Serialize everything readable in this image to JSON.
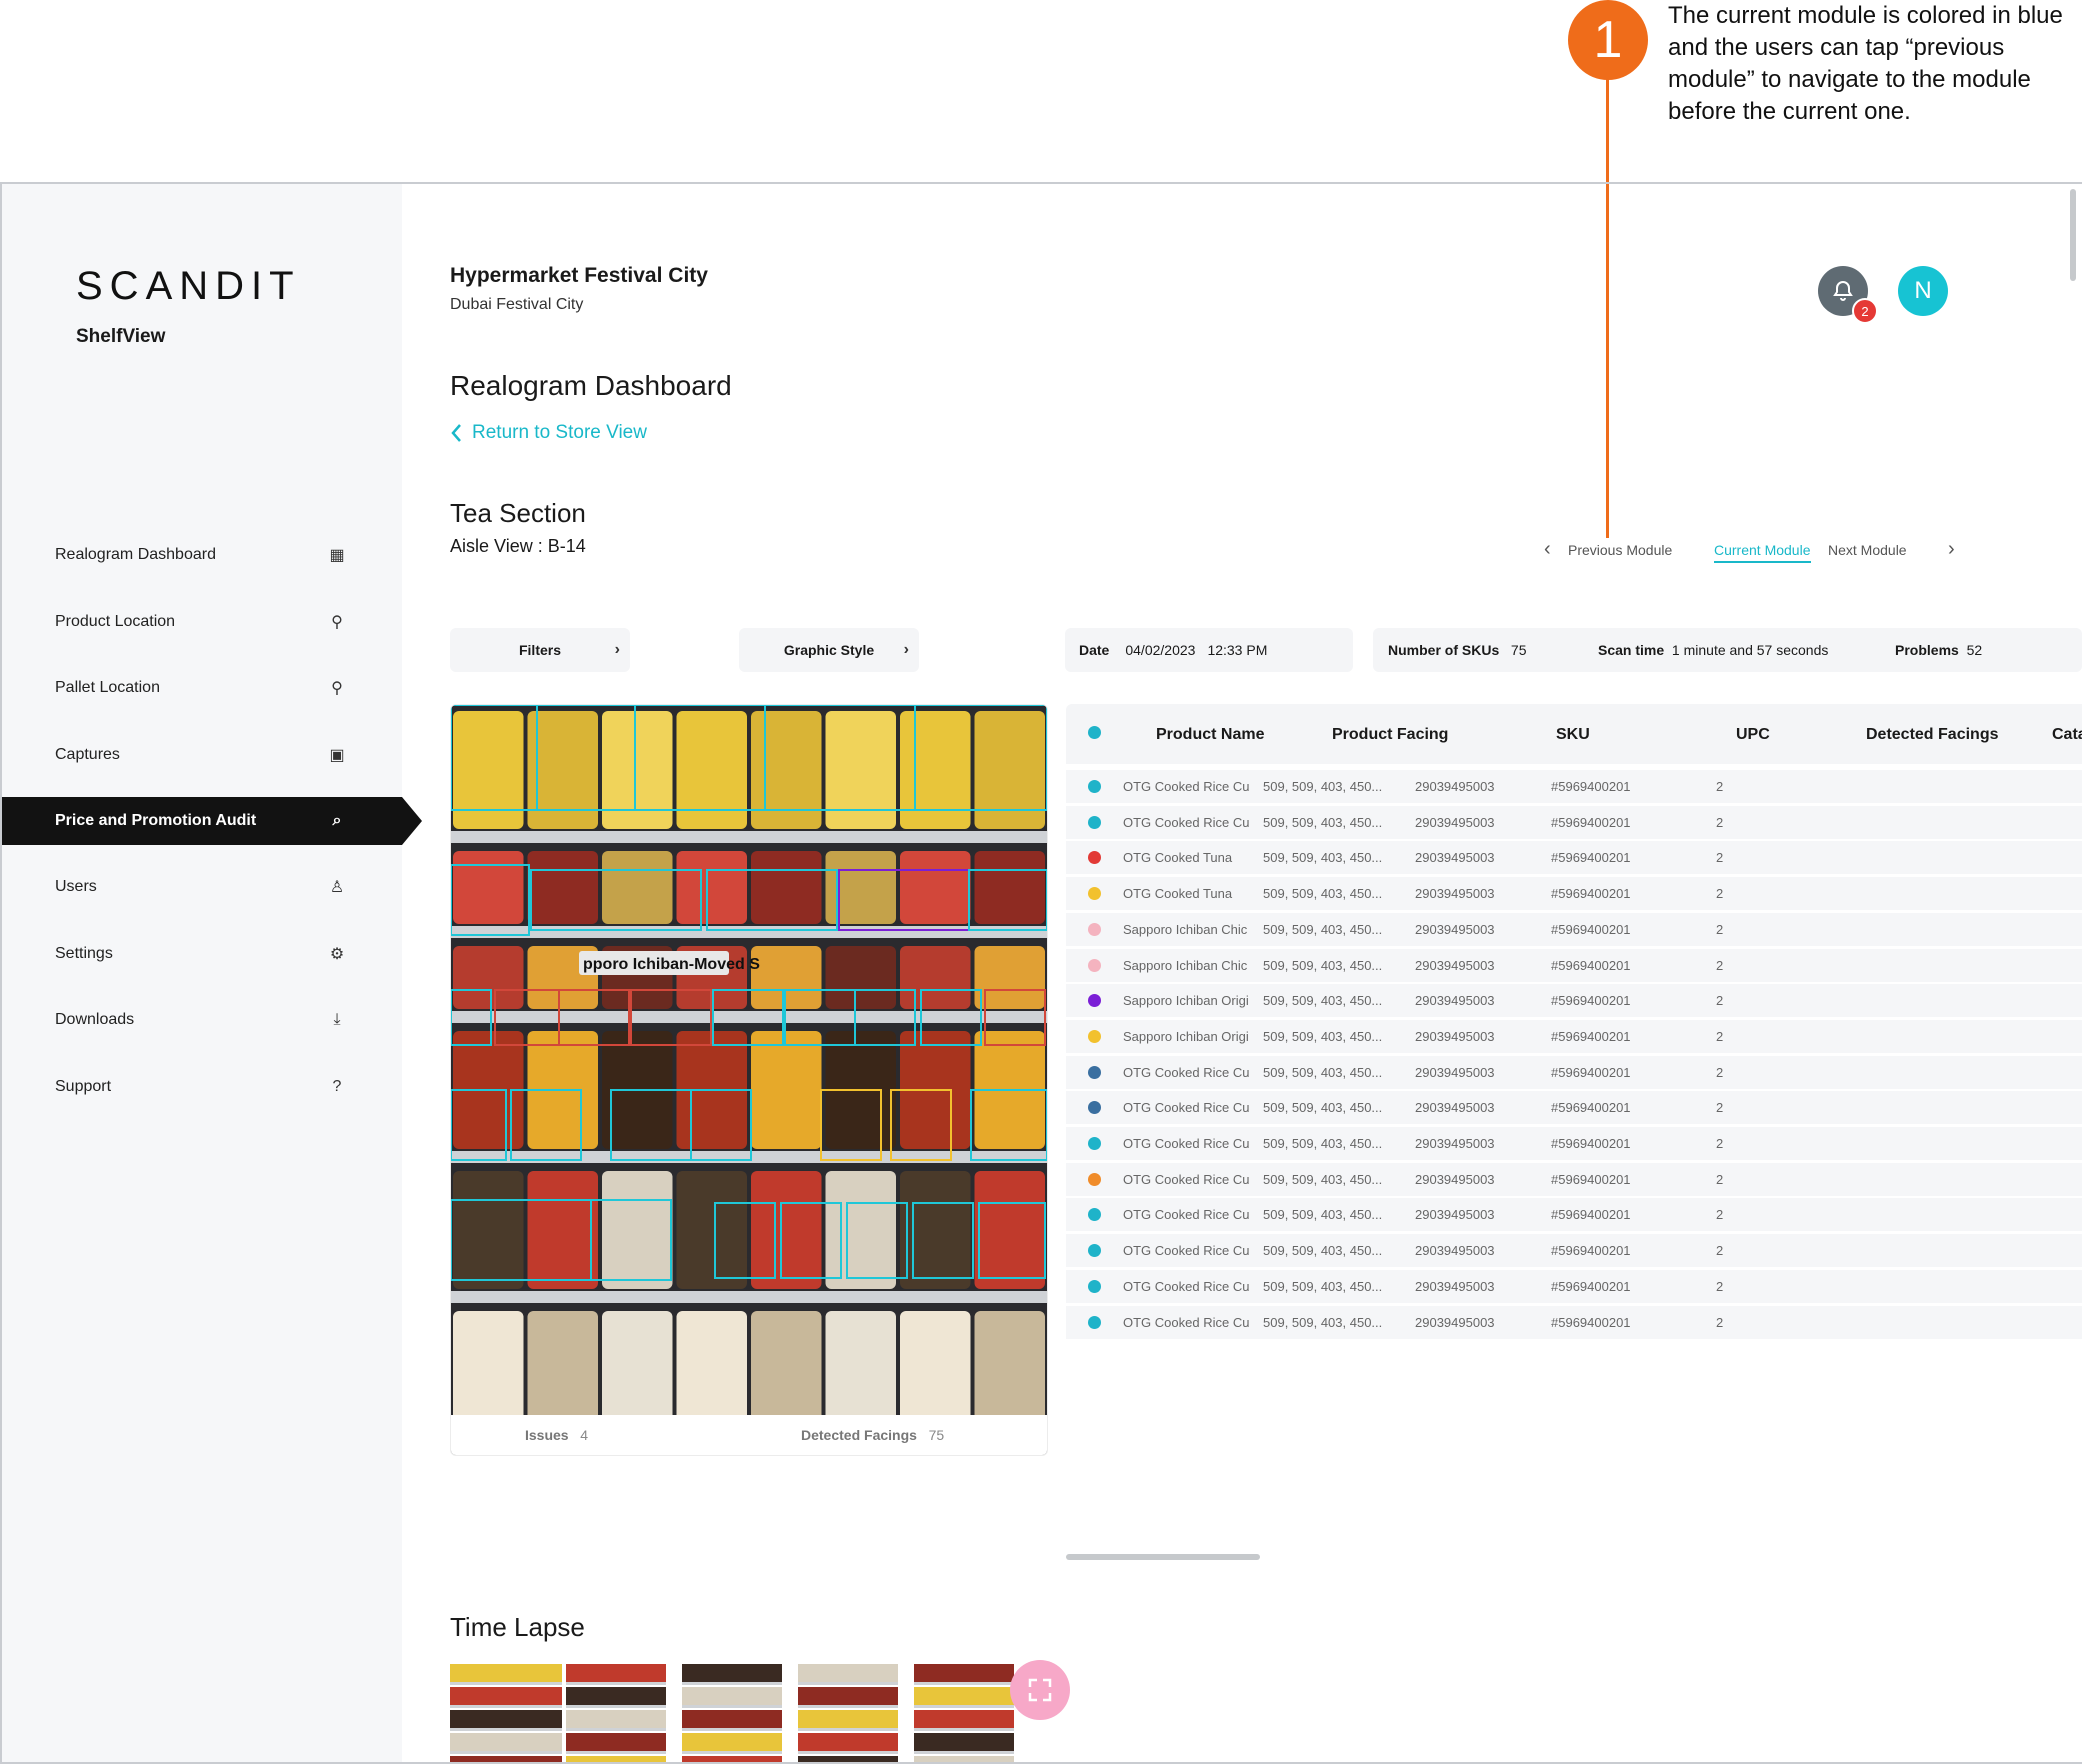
{
  "annotation": {
    "number": "1",
    "text": "The current module is colored in blue and the users can tap “previous module” to navigate to the module before the current one."
  },
  "brand": {
    "logo": "SCANDIT",
    "product": "ShelfView"
  },
  "nav": [
    {
      "label": "Realogram Dashboard",
      "icon": "dashboard-grid-icon",
      "glyph": "▦"
    },
    {
      "label": "Product Location",
      "icon": "location-pin-icon",
      "glyph": "⚲"
    },
    {
      "label": "Pallet Location",
      "icon": "location-pin-icon",
      "glyph": "⚲"
    },
    {
      "label": "Captures",
      "icon": "image-icon",
      "glyph": "▣"
    },
    {
      "label": "Price and Promotion Audit",
      "icon": "audit-search-icon",
      "glyph": "⌕",
      "active": true
    },
    {
      "label": "Users",
      "icon": "user-edit-icon",
      "glyph": "♙"
    },
    {
      "label": "Settings",
      "icon": "gear-icon",
      "glyph": "⚙"
    },
    {
      "label": "Downloads",
      "icon": "download-icon",
      "glyph": "⤓"
    },
    {
      "label": "Support",
      "icon": "help-circle-icon",
      "glyph": "?"
    }
  ],
  "header": {
    "store_name": "Hypermarket Festival City",
    "store_location": "Dubai Festival City",
    "notifications": "2",
    "avatar_initial": "N"
  },
  "page": {
    "title": "Realogram Dashboard",
    "back_link": "Return to Store View",
    "section": "Tea Section",
    "aisle": "Aisle View : B-14"
  },
  "module_nav": {
    "previous": "Previous Module",
    "current": "Current Module",
    "next": "Next Module"
  },
  "toolbar": {
    "filters": "Filters",
    "graphic_style": "Graphic Style",
    "date_label": "Date",
    "date_value": "04/02/2023",
    "time_value": "12:33 PM",
    "skus_label": "Number of SKUs",
    "skus_value": "75",
    "scan_label": "Scan time",
    "scan_value": "1 minute and 57 seconds",
    "problems_label": "Problems",
    "problems_value": "52"
  },
  "image_panel": {
    "overlay_label": "pporo Ichiban-Moved S",
    "issues_label": "Issues",
    "issues_value": "4",
    "facings_label": "Detected Facings",
    "facings_value": "75"
  },
  "table": {
    "columns": [
      "Product Name",
      "Product Facing",
      "SKU",
      "UPC",
      "Detected Facings",
      "Cata"
    ],
    "rows": [
      {
        "color": "#1fb3c9",
        "name": "OTG Cooked Rice Cu",
        "facing": "509, 509, 403, 450...",
        "sku": "29039495003",
        "upc": "#5969400201",
        "detected": "2"
      },
      {
        "color": "#1fb3c9",
        "name": "OTG Cooked Rice Cu",
        "facing": "509, 509, 403, 450...",
        "sku": "29039495003",
        "upc": "#5969400201",
        "detected": "2"
      },
      {
        "color": "#e23a36",
        "name": "OTG Cooked Tuna",
        "facing": "509, 509, 403, 450...",
        "sku": "29039495003",
        "upc": "#5969400201",
        "detected": "2"
      },
      {
        "color": "#f2c12e",
        "name": "OTG Cooked Tuna",
        "facing": "509, 509, 403, 450...",
        "sku": "29039495003",
        "upc": "#5969400201",
        "detected": "2"
      },
      {
        "color": "#f4b3bf",
        "name": "Sapporo Ichiban Chic",
        "facing": "509, 509, 403, 450...",
        "sku": "29039495003",
        "upc": "#5969400201",
        "detected": "2"
      },
      {
        "color": "#f4b3bf",
        "name": "Sapporo Ichiban Chic",
        "facing": "509, 509, 403, 450...",
        "sku": "29039495003",
        "upc": "#5969400201",
        "detected": "2"
      },
      {
        "color": "#7b1fd6",
        "name": "Sapporo Ichiban Origi",
        "facing": "509, 509, 403, 450...",
        "sku": "29039495003",
        "upc": "#5969400201",
        "detected": "2"
      },
      {
        "color": "#f2c12e",
        "name": "Sapporo Ichiban Origi",
        "facing": "509, 509, 403, 450...",
        "sku": "29039495003",
        "upc": "#5969400201",
        "detected": "2"
      },
      {
        "color": "#3a6fa0",
        "name": "OTG Cooked Rice Cu",
        "facing": "509, 509, 403, 450...",
        "sku": "29039495003",
        "upc": "#5969400201",
        "detected": "2"
      },
      {
        "color": "#3a6fa0",
        "name": "OTG Cooked Rice Cu",
        "facing": "509, 509, 403, 450...",
        "sku": "29039495003",
        "upc": "#5969400201",
        "detected": "2"
      },
      {
        "color": "#1fb3c9",
        "name": "OTG Cooked Rice Cu",
        "facing": "509, 509, 403, 450...",
        "sku": "29039495003",
        "upc": "#5969400201",
        "detected": "2"
      },
      {
        "color": "#f08c2a",
        "name": "OTG Cooked Rice Cu",
        "facing": "509, 509, 403, 450...",
        "sku": "29039495003",
        "upc": "#5969400201",
        "detected": "2"
      },
      {
        "color": "#1fb3c9",
        "name": "OTG Cooked Rice Cu",
        "facing": "509, 509, 403, 450...",
        "sku": "29039495003",
        "upc": "#5969400201",
        "detected": "2"
      },
      {
        "color": "#1fb3c9",
        "name": "OTG Cooked Rice Cu",
        "facing": "509, 509, 403, 450...",
        "sku": "29039495003",
        "upc": "#5969400201",
        "detected": "2"
      },
      {
        "color": "#1fb3c9",
        "name": "OTG Cooked Rice Cu",
        "facing": "509, 509, 403, 450...",
        "sku": "29039495003",
        "upc": "#5969400201",
        "detected": "2"
      },
      {
        "color": "#1fb3c9",
        "name": "OTG Cooked Rice Cu",
        "facing": "509, 509, 403, 450...",
        "sku": "29039495003",
        "upc": "#5969400201",
        "detected": "2"
      }
    ]
  },
  "time_lapse": {
    "title": "Time Lapse",
    "thumbnail_count": 5
  },
  "colors": {
    "accent": "#19b8c9",
    "annotation": "#ef6c1a",
    "active_nav": "#121212",
    "badge": "#e53935"
  }
}
